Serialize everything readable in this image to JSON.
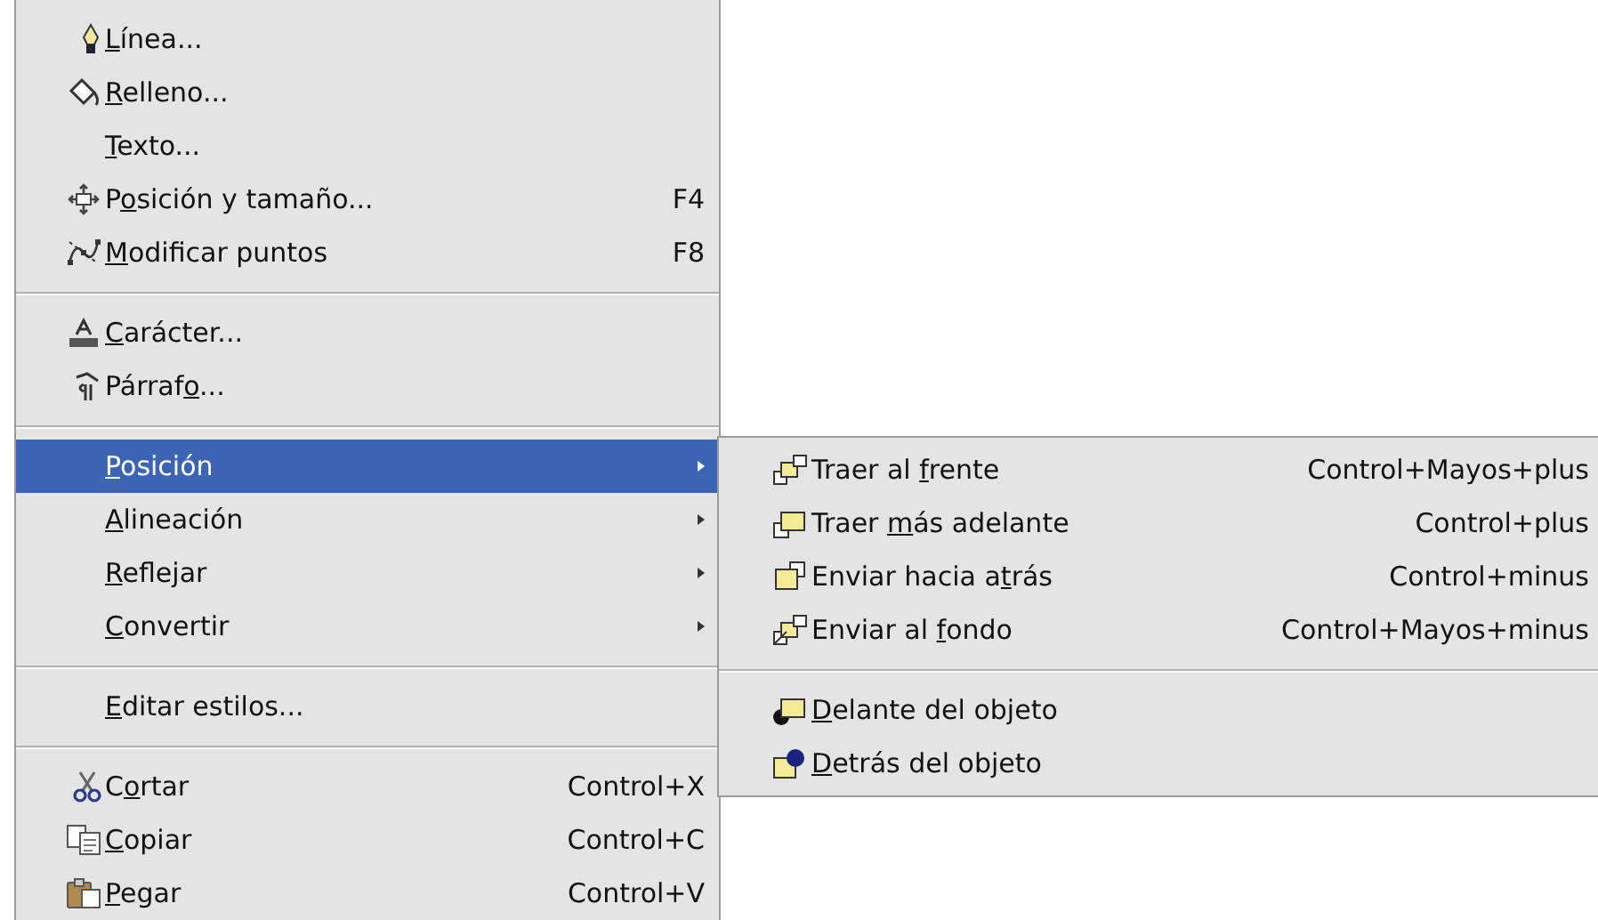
{
  "context_menu": {
    "items": [
      {
        "kind": "command",
        "key": "L",
        "post": "ínea...",
        "selected": false
      },
      {
        "kind": "command",
        "key": "R",
        "post": "elleno...",
        "selected": false
      },
      {
        "kind": "command",
        "key": "T",
        "post": "exto...",
        "selected": false
      },
      {
        "kind": "command",
        "pre": "P",
        "key": "o",
        "post": "sición y tamaño...",
        "shortcut": "F4",
        "selected": false
      },
      {
        "kind": "command",
        "key": "M",
        "post": "odificar puntos",
        "shortcut": "F8",
        "selected": false
      },
      {
        "kind": "separator"
      },
      {
        "kind": "command",
        "key": "C",
        "post": "arácter...",
        "selected": false
      },
      {
        "kind": "command",
        "pre": "Párraf",
        "key": "o",
        "post": "...",
        "selected": false
      },
      {
        "kind": "separator"
      },
      {
        "kind": "submenu",
        "key": "P",
        "post": "osición",
        "selected": true
      },
      {
        "kind": "submenu",
        "key": "A",
        "post": "lineación",
        "selected": false
      },
      {
        "kind": "submenu",
        "key": "R",
        "post": "eflejar",
        "selected": false
      },
      {
        "kind": "submenu",
        "key": "C",
        "post": "onvertir",
        "selected": false
      },
      {
        "kind": "separator"
      },
      {
        "kind": "command",
        "key": "E",
        "post": "ditar estilos...",
        "selected": false
      },
      {
        "kind": "separator"
      },
      {
        "kind": "command",
        "pre": "C",
        "key": "o",
        "post": "rtar",
        "shortcut": "Control+X",
        "selected": false
      },
      {
        "kind": "command",
        "key": "C",
        "post": "opiar",
        "shortcut": "Control+C",
        "selected": false
      },
      {
        "kind": "command",
        "key": "P",
        "post": "egar",
        "shortcut": "Control+V",
        "selected": false
      }
    ]
  },
  "submenu": {
    "items": [
      {
        "kind": "command",
        "pre": "Traer al ",
        "key": "f",
        "post": "rente",
        "shortcut": "Control+Mayos+plus",
        "selected": false
      },
      {
        "kind": "command",
        "pre": "Traer ",
        "key": "m",
        "post": "ás adelante",
        "shortcut": "Control+plus",
        "selected": false
      },
      {
        "kind": "command",
        "pre": "Enviar hacia a",
        "key": "t",
        "post": "rás",
        "shortcut": "Control+minus",
        "selected": false
      },
      {
        "kind": "command",
        "pre": "Enviar al ",
        "key": "f",
        "post": "ondo",
        "shortcut": "Control+Mayos+minus",
        "selected": false
      },
      {
        "kind": "separator"
      },
      {
        "kind": "command",
        "key": "D",
        "post": "elante del objeto",
        "selected": false
      },
      {
        "kind": "command",
        "key": "D",
        "post": "etrás del objeto",
        "selected": false
      }
    ]
  }
}
